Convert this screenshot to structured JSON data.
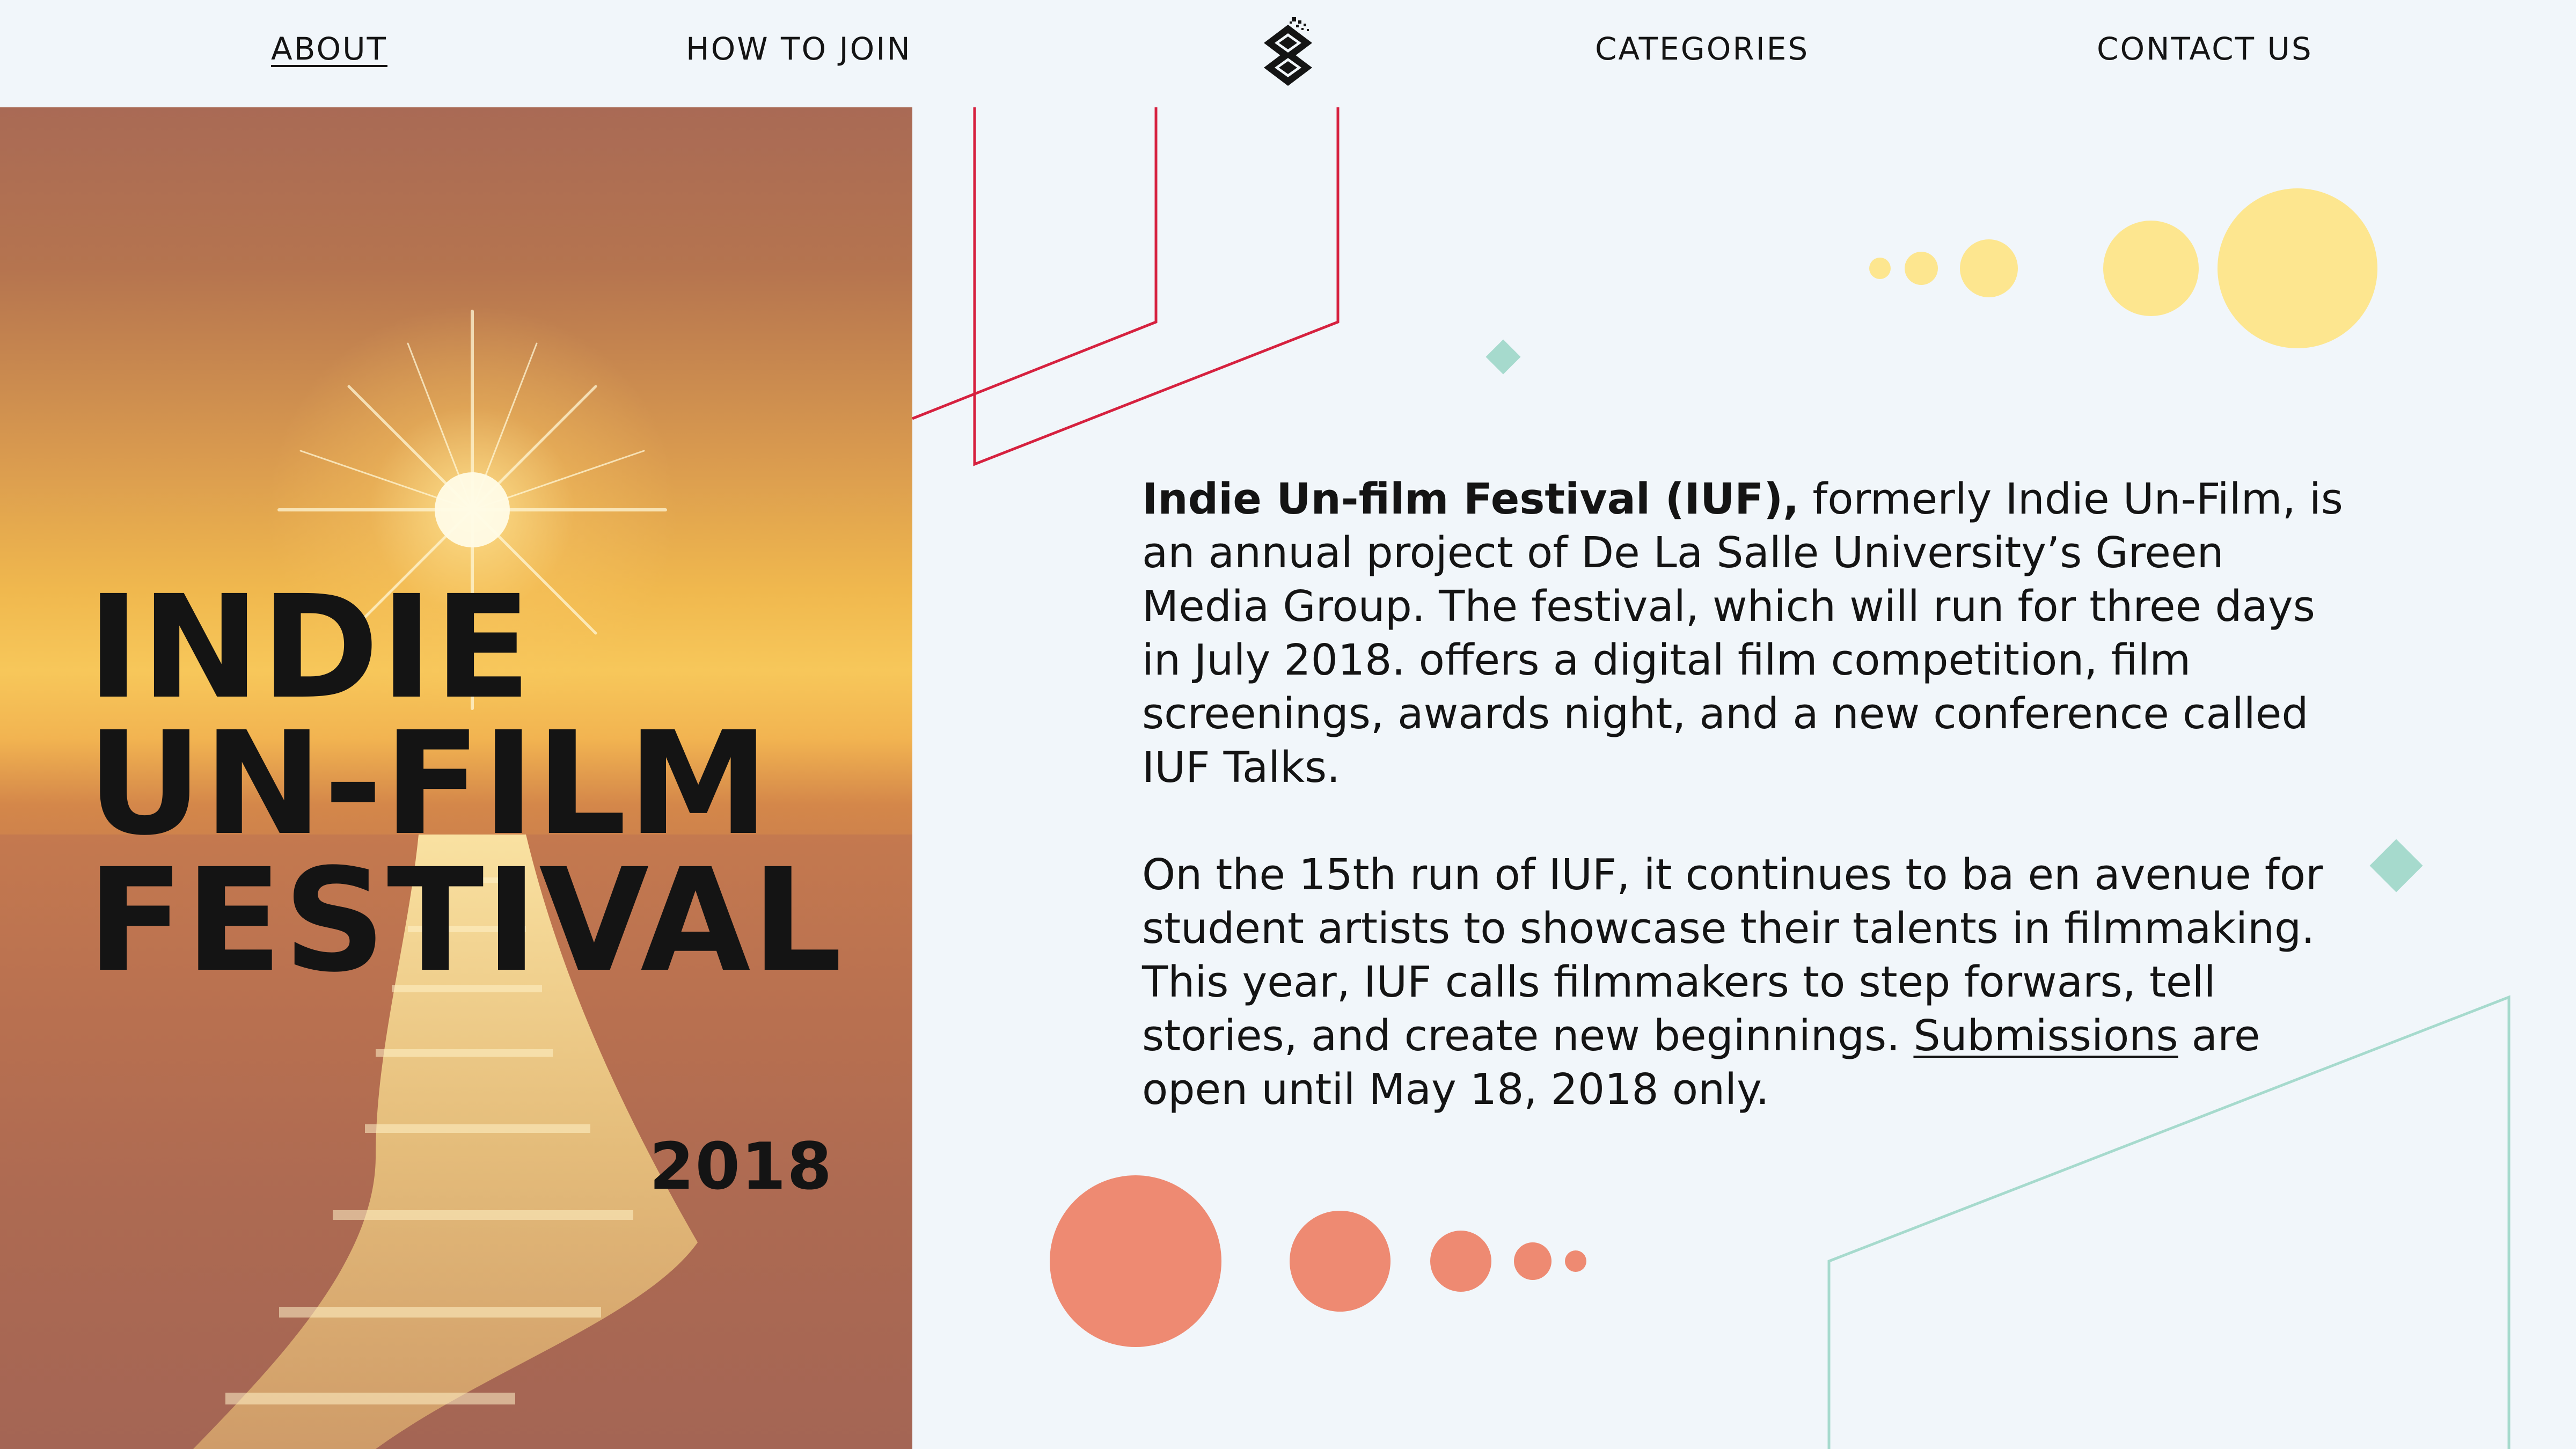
{
  "nav": {
    "about": "ABOUT",
    "how_to_join": "HOW TO JOIN",
    "categories": "CATEGORIES",
    "contact_us": "CONTACT US",
    "active": "about"
  },
  "poster": {
    "title_line1": "INDIE",
    "title_line2": "UN-FILM",
    "title_line3": "FESTIVAL",
    "year": "2018"
  },
  "about": {
    "p1_bold": "Indie Un-film Festival (IUF),",
    "p1_rest": " formerly Indie Un-Film, is an annual project of De La Salle University’s Green Media Group. The festival, which will run for three days in July 2018. offers a digital film competition, film screenings, awards night, and a new conference called IUF Talks.",
    "p2_before": "On the 15th run of IUF, it continues to ba en avenue for student artists to showcase their talents in filmmaking. This year, IUF calls filmmakers to step forwars, tell stories, and create new beginnings. ",
    "p2_link": "Submissions",
    "p2_after": " are open until May 18, 2018 only."
  },
  "colors": {
    "background": "#f1f6fa",
    "text": "#141414",
    "red_line": "#d6213f",
    "teal": "#a6dacd",
    "yellow_dot": "#fde68f",
    "coral_dot": "#ee8a72"
  }
}
